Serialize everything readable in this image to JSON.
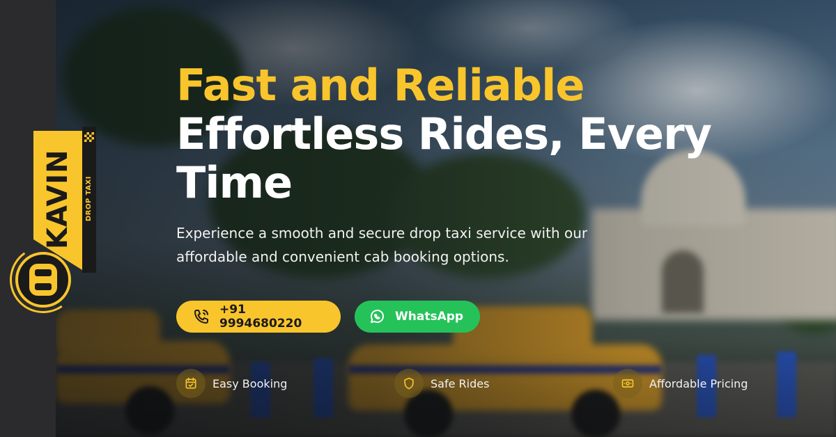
{
  "brand": {
    "name": "KAVIN",
    "tagline": "DROP TAXI",
    "accent_color": "#f9c52c",
    "dark_color": "#1a1a1a"
  },
  "hero": {
    "headline_accent": "Fast and Reliable",
    "headline_main": "Effortless Rides, Every Time",
    "subtitle": "Experience a smooth and secure drop taxi service with our affordable and convenient cab booking options."
  },
  "cta": {
    "phone": {
      "label": "+91 9994680220",
      "icon": "phone-icon",
      "color": "#f9c52c"
    },
    "whatsapp": {
      "label": "WhatsApp",
      "icon": "whatsapp-icon",
      "color": "#25c25a"
    }
  },
  "features": [
    {
      "label": "Easy Booking",
      "icon": "calendar-check-icon"
    },
    {
      "label": "Safe Rides",
      "icon": "shield-icon"
    },
    {
      "label": "Affordable Pricing",
      "icon": "money-icon"
    }
  ]
}
